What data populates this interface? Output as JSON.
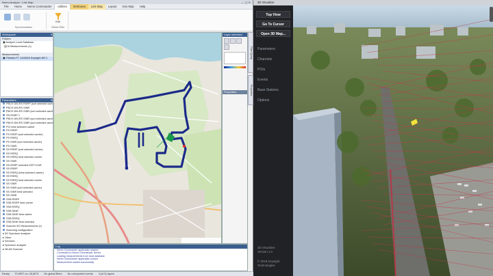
{
  "app": {
    "title": "Nemo Analyze - Link Map",
    "tabs": [
      "File",
      "Home",
      "Nemo Commander",
      "Utilities",
      "Workspace",
      "Layout",
      "Geo Map",
      "Help"
    ],
    "context_tabs": [
      "Workarea",
      "Link Map"
    ],
    "ribbon_groups": [
      "Synchronization",
      "Global Filter"
    ],
    "ribbon_button": "Edit"
  },
  "workspace": {
    "header": "Workspace",
    "folders_label": "Folders",
    "tree": [
      "Analyze Local Database",
      "M Measurements (1)"
    ],
    "measurements_label": "Measurements",
    "measurement_file": "TMobile-FT 1410816 Keysight-NR.1"
  },
  "parameters": {
    "header": "Parameters",
    "items": [
      "PBCH DM-RS RSRP (sort selected carrier)",
      "PBCH DM-RS SINR",
      "PBCH DM-RS SINR (sort selected carrier)",
      "SS-RSRP 1",
      "PBCH DM-RS SINR (sort selected carrier)",
      "PBCH DM-RS SINR (sort selected carrier)",
      "PCI best selected carrier",
      "PS RSRP",
      "PS RSRP (sort selected carrier)",
      "PS RSRQ",
      "PS SINR (sort selected carrier)",
      "PS SINR",
      "SS RSRP (sort selected carrier)",
      "SS RSRQ",
      "SS RSRQ best selected carrier",
      "SS SINR",
      "SS-RSRP selected ONTYCAR",
      "SS RSRP",
      "SS RSRQ (best selected carrier)",
      "SS RSRQ",
      "SS RSRQ best selected carrier",
      "SS SINR",
      "SS SINR (sort selected carrier)",
      "SS SINR best selected",
      "SS-SINR",
      "SSB RSRP",
      "SSB RSRP best carrier",
      "SSB RSRQ",
      "SSB SINR",
      "SSB SINR best carrier",
      "SSB RSRQ",
      "SSB SINR best selected",
      "Scanner 5G Measurements (1)",
      "Scanning configuration"
    ],
    "footer": [
      "5G Spectrum analyzer",
      "Other",
      "Services",
      "Spectrum analyzer",
      "WLAN Scanner"
    ]
  },
  "map_side": {
    "header": "Layer selection",
    "sub": "Properties"
  },
  "vtabs": [
    "Filter Query",
    "Properties"
  ],
  "log": {
    "header": "Log",
    "lines": [
      "Nemo Commander application started",
      "Connected to Nemo Commander Server",
      "Loading measurements from local database",
      "Nemo Commander application closed",
      "Measurement loaded successfully"
    ]
  },
  "status": {
    "items": [
      "Ready",
      "PL/NR7 on: 45,8070",
      "No global filters",
      "No unimported events",
      "4 (of 5) layers"
    ]
  },
  "visualizer": {
    "title": "3D Visualizer",
    "buttons": [
      "Top View",
      "Go To Cursor",
      "Open 3D Map..."
    ],
    "menu": [
      "Parameters",
      "Channels",
      "POIs",
      "Events",
      "Base Stations",
      "Options"
    ],
    "version": [
      "3D Visualizer",
      "Version 1.0"
    ],
    "copyright": [
      "© 2019 Keysight",
      "Technologies"
    ]
  },
  "colors": {
    "route": "#1b2a8a",
    "accent": "#3a5f8f",
    "signal_lines": "#c03a4a"
  }
}
